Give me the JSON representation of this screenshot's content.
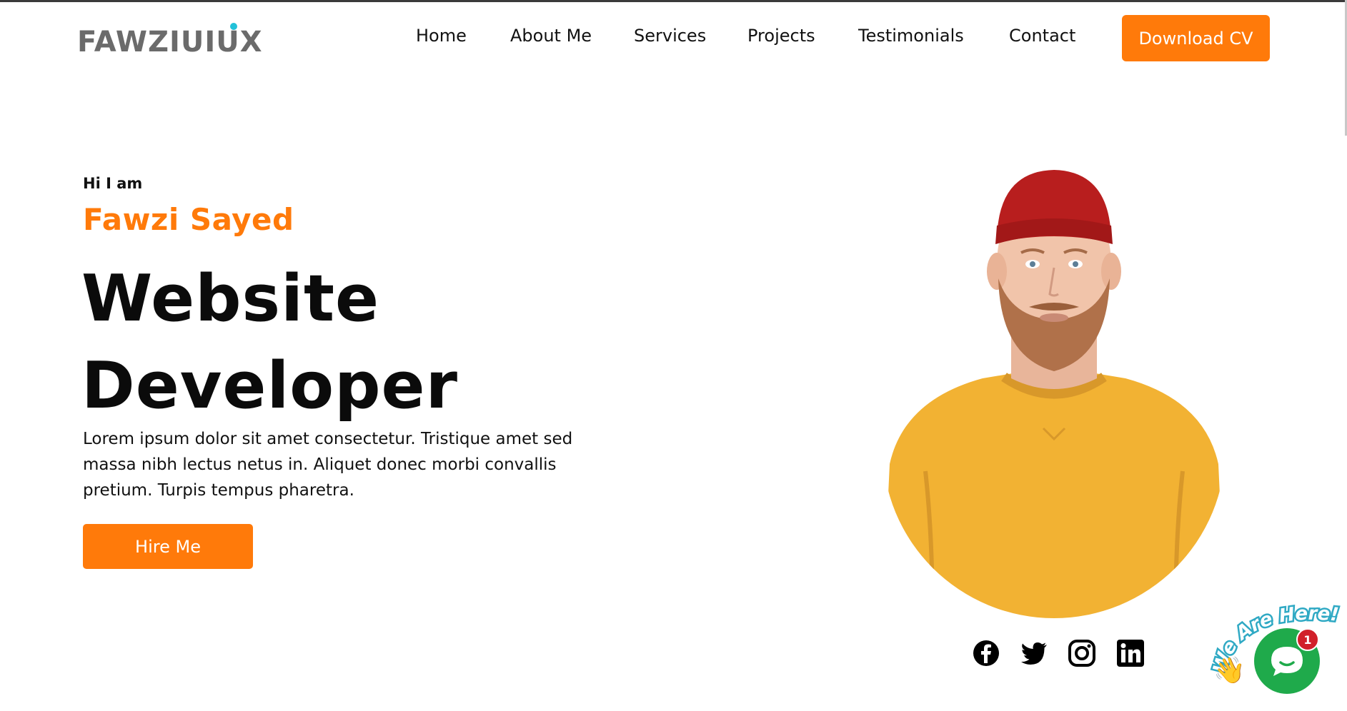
{
  "brand": {
    "logo_text": "FAWZIUIUX"
  },
  "nav": {
    "items": [
      "Home",
      "About Me",
      "Services",
      "Projects",
      "Testimonials",
      "Contact"
    ],
    "cta_label": "Download CV"
  },
  "hero": {
    "greeting": "Hi I am",
    "name": "Fawzi Sayed",
    "role_line1": "Website",
    "role_line2": "Developer",
    "description": "Lorem ipsum dolor sit amet consectetur. Tristique amet sed massa nibh lectus netus in. Aliquet donec morbi convallis pretium. Turpis tempus pharetra.",
    "cta_label": "Hire Me"
  },
  "social": [
    "facebook-icon",
    "twitter-icon",
    "instagram-icon",
    "linkedin-icon"
  ],
  "chat": {
    "banner_text": "We Are Here!",
    "badge_count": "1"
  },
  "colors": {
    "accent": "#ff7a0a",
    "chat_green": "#1faa4b",
    "badge_red": "#d1202a"
  }
}
